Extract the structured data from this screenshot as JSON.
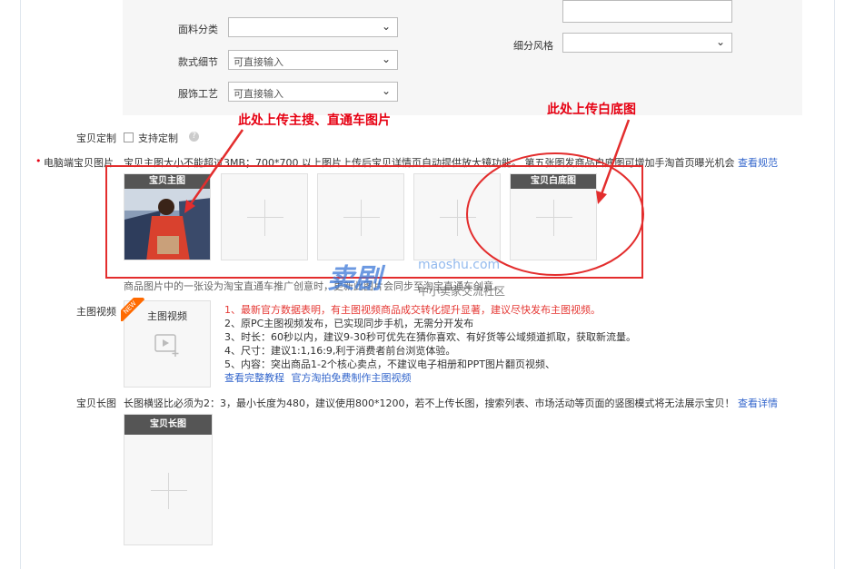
{
  "colors": {
    "accent_red": "#e32d2d",
    "link_blue": "#3366cc"
  },
  "attributes": {
    "fabric_category_label": "面料分类",
    "style_detail_label": "款式细节",
    "style_detail_placeholder": "可直接输入",
    "craft_label": "服饰工艺",
    "craft_placeholder": "可直接输入",
    "sub_style_label": "细分风格"
  },
  "annotations": {
    "left_callout": "此处上传主搜、直通车图片",
    "right_callout": "此处上传白底图"
  },
  "custom": {
    "label": "宝贝定制",
    "checkbox_label": "支持定制",
    "help_icon": "question-circle-icon"
  },
  "pc_images": {
    "required_mark": "•",
    "label": "电脑端宝贝图片",
    "tip": "宝贝主图大小不能超过3MB；700*700 以上图片上传后宝贝详情页自动提供放大镜功能。 第五张图发商品白底图可增加手淘首页曝光机会",
    "tip_link": "查看规范",
    "main_image_label": "宝贝主图",
    "white_bg_label": "宝贝白底图",
    "footer_note": "商品图片中的一张设为淘宝直通车推广创意时，更新此图片会同步至淘宝直通车创意。"
  },
  "watermark": {
    "line1": "卖剧",
    "line2": "中小卖家交流社区",
    "site": "maoshu.com"
  },
  "main_video": {
    "label": "主图视频",
    "box_label": "主图视频",
    "new_badge": "NEW",
    "tips": [
      "1、最新官方数据表明，有主图视频商品成交转化提升显著，建议尽快发布主图视频。",
      "2、原PC主图视频发布，已实现同步手机，无需分开发布",
      "3、时长：60秒以内，建议9-30秒可优先在猜你喜欢、有好货等公域频道抓取，获取新流量。",
      "4、尺寸：建议1:1,16:9,利于消费者前台浏览体验。",
      "5、内容：突出商品1-2个核心卖点，不建议电子相册和PPT图片翻页视频、"
    ],
    "link1": "查看完整教程",
    "link2": "官方淘拍免费制作主图视频"
  },
  "long_image": {
    "label": "宝贝长图",
    "tip": "长图横竖比必须为2：3，最小长度为480，建议使用800*1200，若不上传长图，搜索列表、市场活动等页面的竖图模式将无法展示宝贝！",
    "tip_link": "查看详情",
    "box_label": "宝贝长图"
  }
}
